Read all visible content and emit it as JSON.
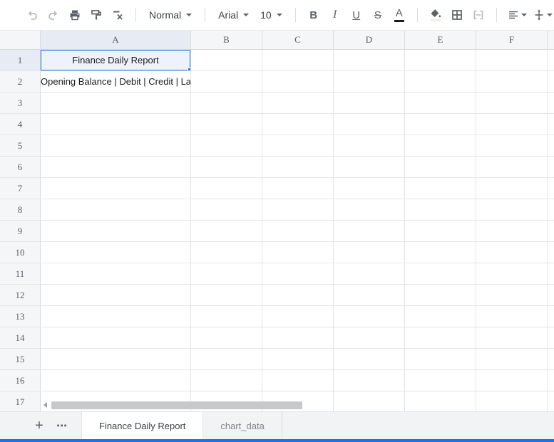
{
  "toolbar": {
    "style_value": "Normal",
    "font_value": "Arial",
    "size_value": "10",
    "bold_label": "B",
    "italic_label": "I",
    "underline_label": "U",
    "strikethrough_label": "S",
    "text_color_label": "A"
  },
  "grid": {
    "column_headers": [
      "A",
      "B",
      "C",
      "D",
      "E",
      "F"
    ],
    "row_headers": [
      "1",
      "2",
      "3",
      "4",
      "5",
      "6",
      "7",
      "8",
      "9",
      "10",
      "11",
      "12",
      "13",
      "14",
      "15",
      "16",
      "17"
    ],
    "cells": {
      "A1": "Finance Daily Report",
      "A2": "Opening Balance | Debit | Credit | Last Balance"
    },
    "selected_cell": "A1",
    "selected_column": "A",
    "selected_row": "1"
  },
  "tabs": {
    "add_label": "+",
    "more_label": "⋯",
    "items": [
      {
        "label": "Finance Daily Report",
        "active": true
      },
      {
        "label": "chart_data",
        "active": false
      }
    ]
  },
  "colors": {
    "accent": "#1a73e8",
    "selection_fill": "#edf2fc",
    "header_highlight": "#e7ebf3"
  }
}
